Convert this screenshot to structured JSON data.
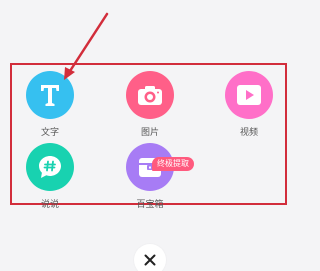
{
  "menu": {
    "items": [
      {
        "label": "文字",
        "icon": "text-icon",
        "color": "#36c0f0"
      },
      {
        "label": "图片",
        "icon": "camera-icon",
        "color": "#ff5f88"
      },
      {
        "label": "视频",
        "icon": "play-icon",
        "color": "#ff6fc8"
      },
      {
        "label": "说说",
        "icon": "chat-hash-icon",
        "color": "#18d2b0"
      },
      {
        "label": "百宝箱",
        "icon": "treasure-box-icon",
        "color": "#a77cf5",
        "badge": "终极提取"
      }
    ]
  },
  "close": {
    "icon": "close-icon"
  },
  "annotation": {
    "color": "#d22d3b"
  }
}
